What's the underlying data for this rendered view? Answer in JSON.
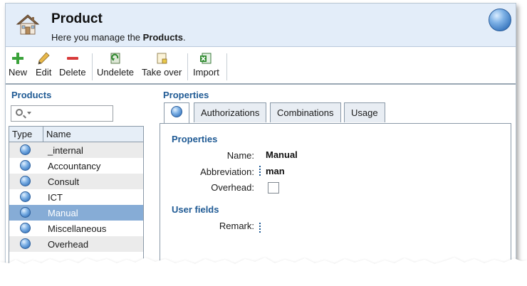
{
  "header": {
    "title": "Product",
    "subtitle_prefix": "Here you manage the ",
    "subtitle_bold": "Products",
    "subtitle_suffix": "."
  },
  "toolbar": {
    "new_label": "New",
    "edit_label": "Edit",
    "delete_label": "Delete",
    "undelete_label": "Undelete",
    "takeover_label": "Take over",
    "import_label": "Import"
  },
  "products": {
    "section_title": "Products",
    "columns": [
      "Type",
      "Name"
    ],
    "items": [
      {
        "name": "_internal",
        "selected": false
      },
      {
        "name": "Accountancy",
        "selected": false
      },
      {
        "name": "Consult",
        "selected": false
      },
      {
        "name": "ICT",
        "selected": false
      },
      {
        "name": "Manual",
        "selected": true
      },
      {
        "name": "Miscellaneous",
        "selected": false
      },
      {
        "name": "Overhead",
        "selected": false
      }
    ]
  },
  "properties": {
    "section_title": "Properties",
    "tabs": [
      "Authorizations",
      "Combinations",
      "Usage"
    ],
    "group_properties": "Properties",
    "name_label": "Name:",
    "name_value": "Manual",
    "abbreviation_label": "Abbreviation:",
    "abbreviation_value": "man",
    "overhead_label": "Overhead:",
    "overhead_checked": false,
    "group_user_fields": "User fields",
    "remark_label": "Remark:",
    "remark_value": ""
  },
  "colors": {
    "header_bg": "#e3edf9",
    "section_title": "#1f5a94",
    "selected_row": "#86acd6"
  }
}
